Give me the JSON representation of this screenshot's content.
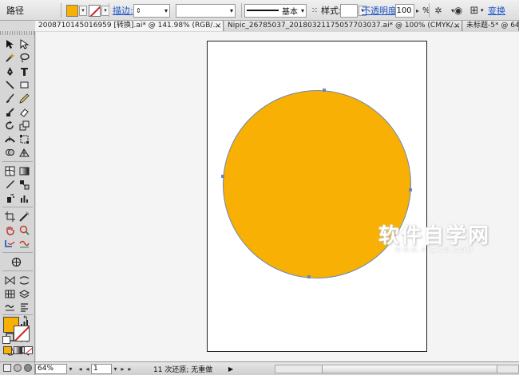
{
  "control_bar": {
    "selection_label": "路径",
    "stroke_link": "描边:",
    "stroke_style_label": "基本",
    "style_label": "样式:",
    "opacity_link": "不透明度:",
    "opacity_value": "100",
    "opacity_unit": "%",
    "isolate_link": "变换"
  },
  "tabs": [
    {
      "label": "2008710145016959 [转换].ai* @ 141.98% (RGB/...",
      "close": "×"
    },
    {
      "label": "Nipic_26785037_20180321175057703037.ai* @ 100% (CMYK/...",
      "close": "×"
    },
    {
      "label": "未标题-5* @ 64",
      "close": "×"
    }
  ],
  "icons": {
    "fill_color": "#f7b003",
    "stroke_none_color": "#d21f1f",
    "canvas_bg": "#f4f4f4",
    "anchor_color": "#6d88b4"
  },
  "status_bar": {
    "zoom": "64%",
    "artboard_number": "1",
    "history_status": "11 次还原; 无重做"
  },
  "watermark": {
    "main": "软件自学网",
    "sub": "WWW.RJZXW.COM"
  }
}
